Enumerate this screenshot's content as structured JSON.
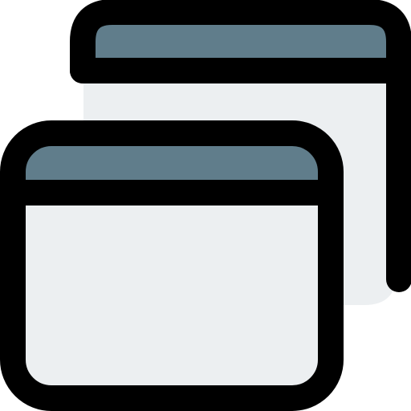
{
  "icon": {
    "name": "multiple-windows-icon",
    "colors": {
      "stroke": "#000000",
      "title_bar": "#607D8B",
      "window_body": "#ECEFF1",
      "background": "#FFFFFF"
    }
  }
}
